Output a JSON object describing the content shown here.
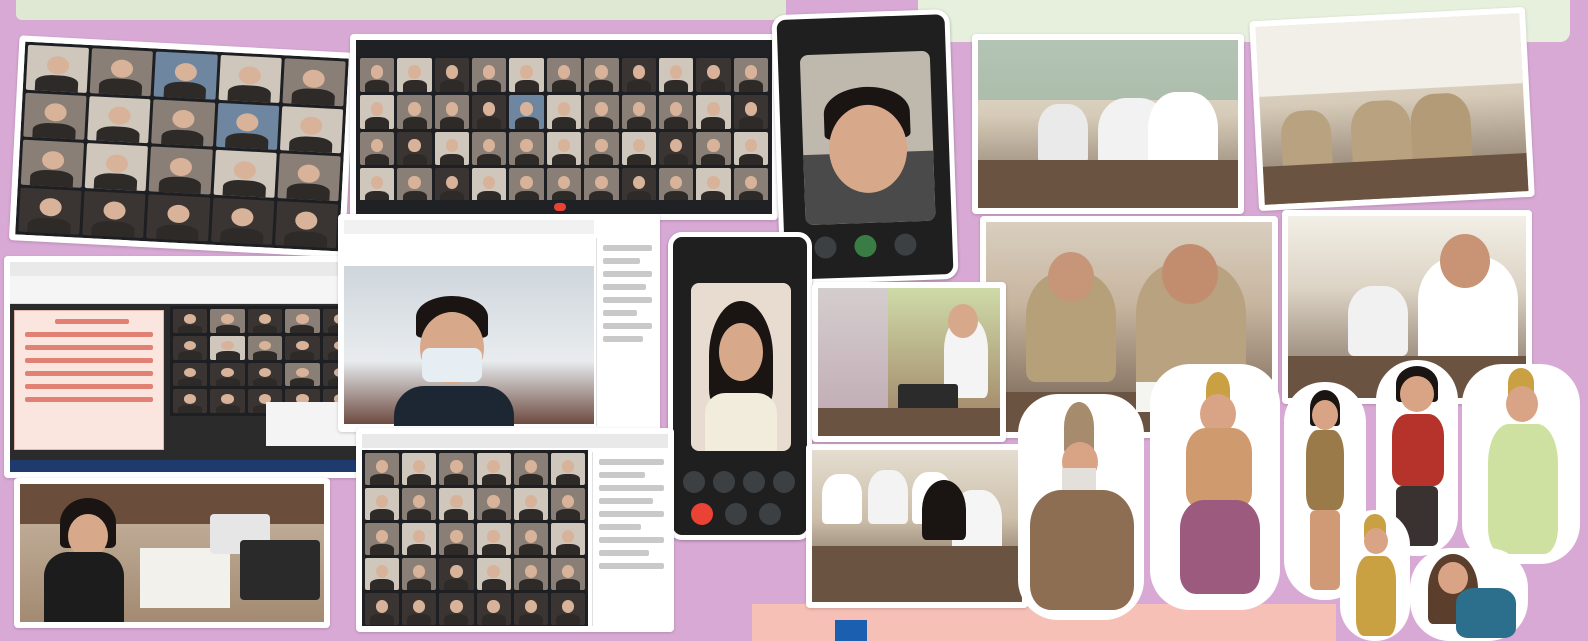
{
  "banners": {
    "left_text": "",
    "right_text": ""
  },
  "colors": {
    "background": "#d9a9d6",
    "top_band": "#dfe8d2",
    "bottom_band": "#f7c0b7",
    "meet_dark": "#1e1f22",
    "end_call": "#ea4335",
    "accent_blue": "#1b5fb0"
  },
  "photos": [
    {
      "name": "zoom-grid-left",
      "kind": "video-call-grid"
    },
    {
      "name": "meet-grid-top",
      "kind": "video-call-grid"
    },
    {
      "name": "phone-call-boy",
      "kind": "phone-video-call"
    },
    {
      "name": "exam-room-1",
      "kind": "classroom"
    },
    {
      "name": "exam-room-2",
      "kind": "classroom"
    },
    {
      "name": "slide-presentation",
      "kind": "screen-share"
    },
    {
      "name": "masked-student-call",
      "kind": "video-call"
    },
    {
      "name": "phone-call-girl",
      "kind": "phone-video-call"
    },
    {
      "name": "boys-writing",
      "kind": "classroom"
    },
    {
      "name": "students-writing",
      "kind": "classroom"
    },
    {
      "name": "teacher-desk",
      "kind": "office"
    },
    {
      "name": "meet-grid-bottom",
      "kind": "video-call-grid"
    },
    {
      "name": "crowded-classroom",
      "kind": "classroom"
    },
    {
      "name": "thai-costume-cutouts",
      "kind": "cutout-figures"
    }
  ],
  "icons": [
    "mic-icon",
    "camera-icon",
    "end-call-icon",
    "more-icon"
  ]
}
